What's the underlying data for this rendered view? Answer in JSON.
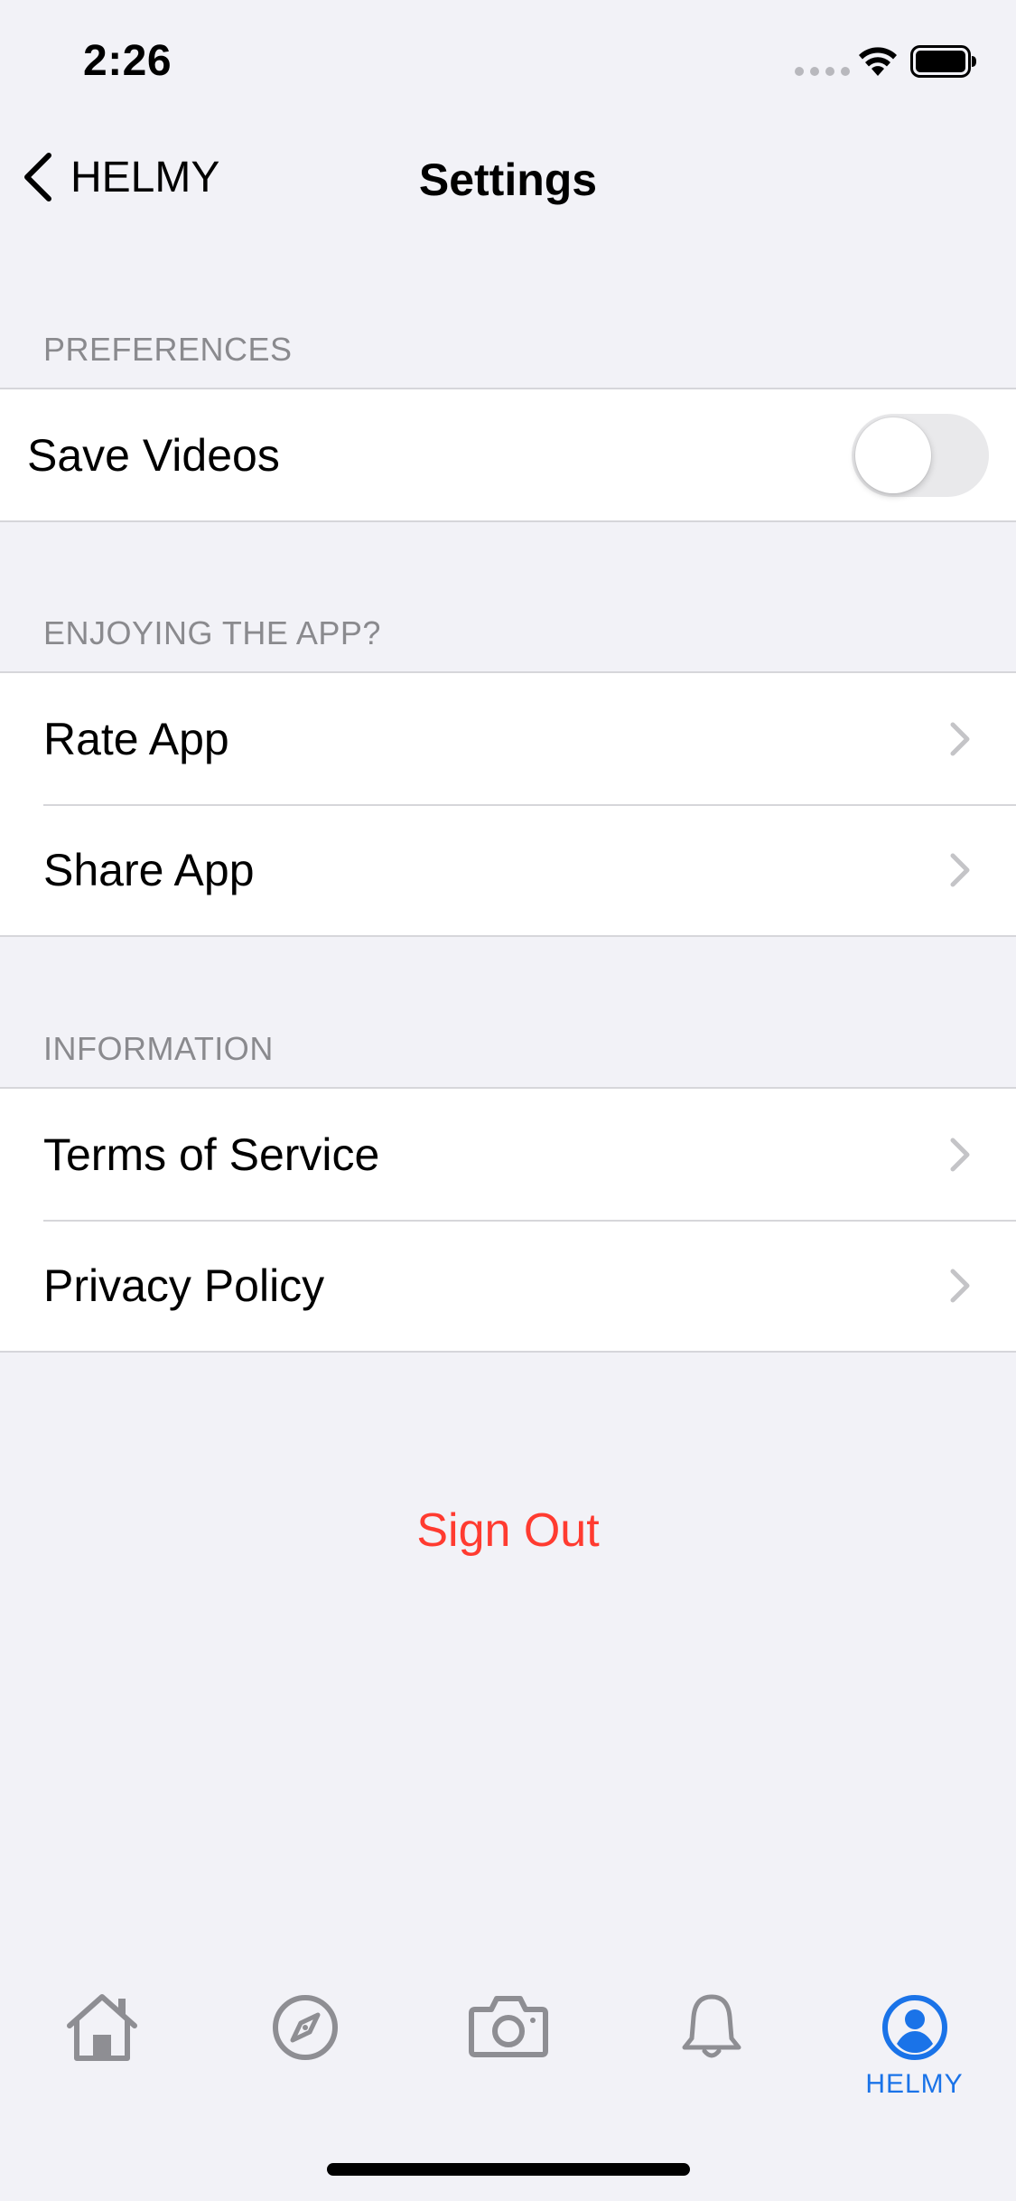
{
  "status_bar": {
    "time": "2:26",
    "icons": [
      "cellular-signal-icon",
      "wifi-icon",
      "battery-icon"
    ]
  },
  "nav": {
    "back_label": "HELMY",
    "title": "Settings"
  },
  "sections": {
    "preferences": {
      "header": "PREFERENCES",
      "save_videos": {
        "label": "Save Videos",
        "toggle_on": false
      }
    },
    "enjoying": {
      "header": "ENJOYING THE APP?",
      "items": [
        {
          "label": "Rate App"
        },
        {
          "label": "Share App"
        }
      ]
    },
    "information": {
      "header": "INFORMATION",
      "items": [
        {
          "label": "Terms of Service"
        },
        {
          "label": "Privacy Policy"
        }
      ]
    }
  },
  "sign_out_label": "Sign Out",
  "tabbar": {
    "tabs": [
      {
        "icon": "home-icon",
        "label": ""
      },
      {
        "icon": "compass-icon",
        "label": ""
      },
      {
        "icon": "camera-icon",
        "label": ""
      },
      {
        "icon": "bell-icon",
        "label": ""
      },
      {
        "icon": "profile-icon",
        "label": "HELMY",
        "selected": true
      }
    ],
    "active_color": "#1a73e8",
    "inactive_color": "#8e8e93"
  },
  "colors": {
    "background": "#f2f2f7",
    "destructive": "#ff3b30",
    "secondary_text": "#8a8a8e"
  }
}
